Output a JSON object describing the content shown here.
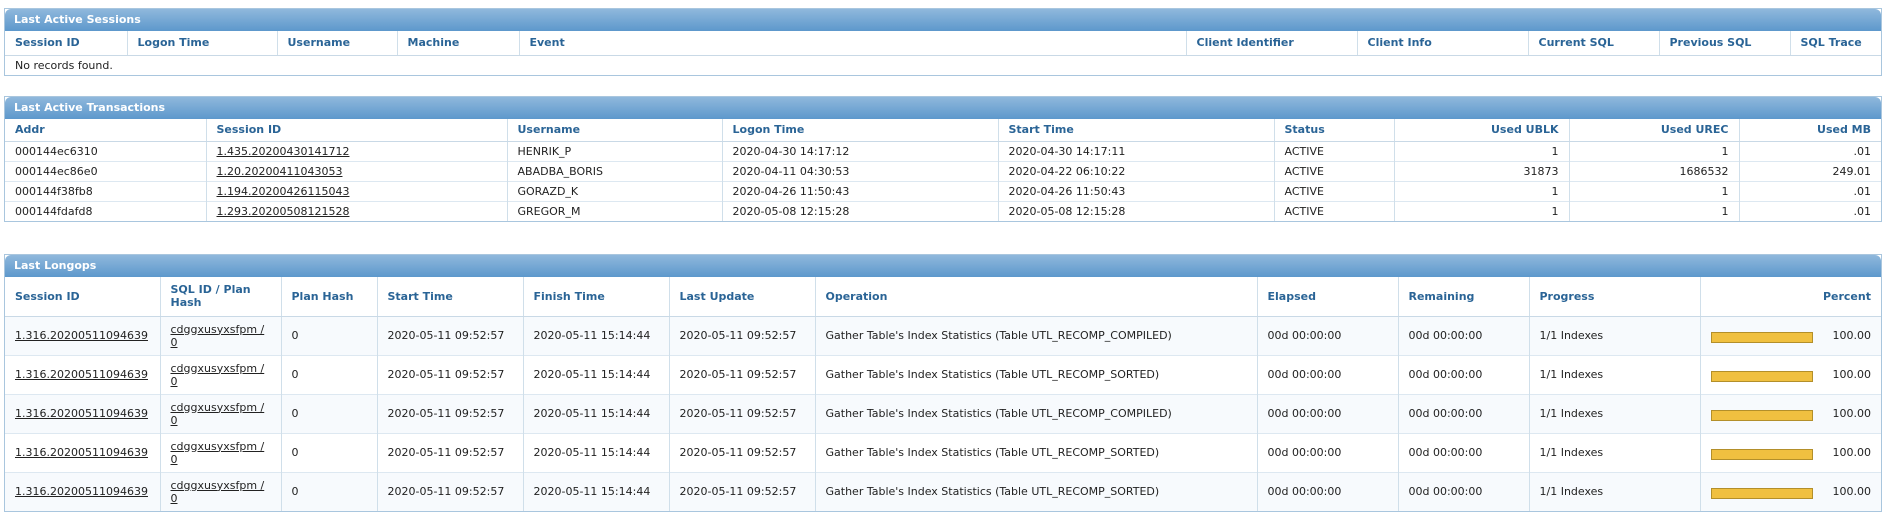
{
  "sessions": {
    "title": "Last Active Sessions",
    "columns": [
      "Session ID",
      "Logon Time",
      "Username",
      "Machine",
      "Event",
      "Client Identifier",
      "Client Info",
      "Current SQL",
      "Previous SQL",
      "SQL Trace"
    ],
    "empty_message": "No records found."
  },
  "transactions": {
    "title": "Last Active Transactions",
    "columns": [
      "Addr",
      "Session ID",
      "Username",
      "Logon Time",
      "Start Time",
      "Status",
      "Used UBLK",
      "Used UREC",
      "Used MB"
    ],
    "rows": [
      {
        "addr": "000144ec6310",
        "session_id": "1.435.20200430141712",
        "username": "HENRIK_P",
        "logon_time": "2020-04-30 14:17:12",
        "start_time": "2020-04-30 14:17:11",
        "status": "ACTIVE",
        "used_ublk": "1",
        "used_urec": "1",
        "used_mb": ".01"
      },
      {
        "addr": "000144ec86e0",
        "session_id": "1.20.20200411043053",
        "username": "ABADBA_BORIS",
        "logon_time": "2020-04-11 04:30:53",
        "start_time": "2020-04-22 06:10:22",
        "status": "ACTIVE",
        "used_ublk": "31873",
        "used_urec": "1686532",
        "used_mb": "249.01"
      },
      {
        "addr": "000144f38fb8",
        "session_id": "1.194.20200426115043",
        "username": "GORAZD_K",
        "logon_time": "2020-04-26 11:50:43",
        "start_time": "2020-04-26 11:50:43",
        "status": "ACTIVE",
        "used_ublk": "1",
        "used_urec": "1",
        "used_mb": ".01"
      },
      {
        "addr": "000144fdafd8",
        "session_id": "1.293.20200508121528",
        "username": "GREGOR_M",
        "logon_time": "2020-05-08 12:15:28",
        "start_time": "2020-05-08 12:15:28",
        "status": "ACTIVE",
        "used_ublk": "1",
        "used_urec": "1",
        "used_mb": ".01"
      }
    ]
  },
  "longops": {
    "title": "Last Longops",
    "columns": [
      "Session ID",
      "SQL ID / Plan Hash",
      "Plan Hash",
      "Start Time",
      "Finish Time",
      "Last Update",
      "Operation",
      "Elapsed",
      "Remaining",
      "Progress",
      "Percent"
    ],
    "rows": [
      {
        "session_id": "1.316.20200511094639",
        "sql_id": "cdggxusyxsfpm /",
        "plan": "0",
        "plan_hash": "0",
        "start_time": "2020-05-11 09:52:57",
        "finish_time": "2020-05-11 15:14:44",
        "last_update": "2020-05-11 09:52:57",
        "operation": "Gather Table's Index Statistics (Table UTL_RECOMP_COMPILED)",
        "elapsed": "00d 00:00:00",
        "remaining": "00d 00:00:00",
        "progress": "1/1 Indexes",
        "percent": "100.00"
      },
      {
        "session_id": "1.316.20200511094639",
        "sql_id": "cdggxusyxsfpm /",
        "plan": "0",
        "plan_hash": "0",
        "start_time": "2020-05-11 09:52:57",
        "finish_time": "2020-05-11 15:14:44",
        "last_update": "2020-05-11 09:52:57",
        "operation": "Gather Table's Index Statistics (Table UTL_RECOMP_SORTED)",
        "elapsed": "00d 00:00:00",
        "remaining": "00d 00:00:00",
        "progress": "1/1 Indexes",
        "percent": "100.00"
      },
      {
        "session_id": "1.316.20200511094639",
        "sql_id": "cdggxusyxsfpm /",
        "plan": "0",
        "plan_hash": "0",
        "start_time": "2020-05-11 09:52:57",
        "finish_time": "2020-05-11 15:14:44",
        "last_update": "2020-05-11 09:52:57",
        "operation": "Gather Table's Index Statistics (Table UTL_RECOMP_COMPILED)",
        "elapsed": "00d 00:00:00",
        "remaining": "00d 00:00:00",
        "progress": "1/1 Indexes",
        "percent": "100.00"
      },
      {
        "session_id": "1.316.20200511094639",
        "sql_id": "cdggxusyxsfpm /",
        "plan": "0",
        "plan_hash": "0",
        "start_time": "2020-05-11 09:52:57",
        "finish_time": "2020-05-11 15:14:44",
        "last_update": "2020-05-11 09:52:57",
        "operation": "Gather Table's Index Statistics (Table UTL_RECOMP_SORTED)",
        "elapsed": "00d 00:00:00",
        "remaining": "00d 00:00:00",
        "progress": "1/1 Indexes",
        "percent": "100.00"
      },
      {
        "session_id": "1.316.20200511094639",
        "sql_id": "cdggxusyxsfpm /",
        "plan": "0",
        "plan_hash": "0",
        "start_time": "2020-05-11 09:52:57",
        "finish_time": "2020-05-11 15:14:44",
        "last_update": "2020-05-11 09:52:57",
        "operation": "Gather Table's Index Statistics (Table UTL_RECOMP_SORTED)",
        "elapsed": "00d 00:00:00",
        "remaining": "00d 00:00:00",
        "progress": "1/1 Indexes",
        "percent": "100.00"
      }
    ]
  }
}
